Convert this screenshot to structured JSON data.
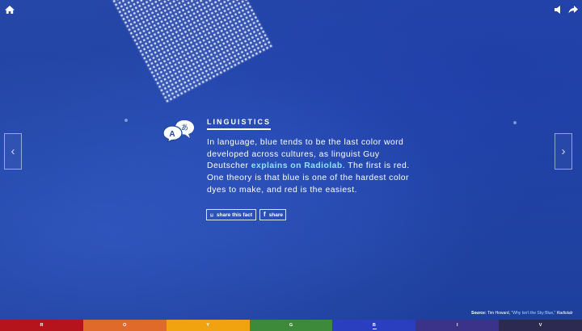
{
  "page": {
    "background_color": "#2044a3"
  },
  "top_controls": {
    "home_icon": "home-icon",
    "sound_icon": "speaker-icon",
    "share_icon": "share-arrow-icon"
  },
  "navigation": {
    "prev_label": "‹",
    "next_label": "›"
  },
  "fact": {
    "topic_icon": "translate-speech-bubbles-icon",
    "icon_letter_latin": "A",
    "icon_letter_kana": "あ",
    "category": "LINGUISTICS",
    "text_before_link": "In language, blue tends to be the last color word developed across cultures, as linguist Guy Deutscher ",
    "link_text": "explains on Radiolab",
    "text_after_link": ". The first is red. One theory is that blue is one of the hardest color dyes to make, and red is the easiest.",
    "link_color": "#8fe3ff",
    "share_fact_label": "share this fact",
    "share_label": "share"
  },
  "source": {
    "label": "Source:",
    "author": "Tim Howard,",
    "title": "\"Why Isn't the Sky Blue,\"",
    "publication": "Radiolab"
  },
  "color_nav": {
    "active_index": 4,
    "items": [
      {
        "letter": "R",
        "color": "#b5141c"
      },
      {
        "letter": "O",
        "color": "#e06a2a"
      },
      {
        "letter": "Y",
        "color": "#f0a30e"
      },
      {
        "letter": "G",
        "color": "#3d8a3a"
      },
      {
        "letter": "B",
        "color": "#2a3fbf"
      },
      {
        "letter": "I",
        "color": "#3b3389"
      },
      {
        "letter": "V",
        "color": "#2d2a52"
      }
    ]
  }
}
